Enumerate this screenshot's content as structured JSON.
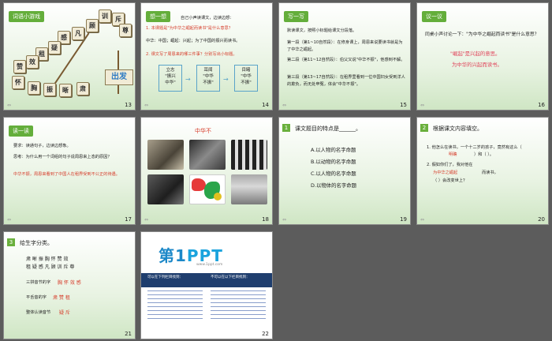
{
  "slides": [
    {
      "num": "13",
      "tag": "词语小游戏",
      "chars": [
        "训",
        "斥",
        "尊",
        "顾",
        "凡",
        "感",
        "疑",
        "租",
        "效",
        "赞",
        "怀",
        "胸",
        "振",
        "晰",
        "肃"
      ],
      "start": "出发"
    },
    {
      "num": "14",
      "header": "想一想",
      "lines": [
        "自己小声读课文，边读边想：",
        "1. 本课题是\"为中华之崛起而读书\"是什么意思？",
        "中华：中国；崛起：兴起；为了中国的振兴而读书。",
        "2. 课文写了周恩来的哪三件事？分别写出小标题。"
      ],
      "boxes": [
        "立志\n\"振兴\n中华\"",
        "耳闻\n\"中华\n不振\"",
        "目睹\n\"中华\n不振\""
      ]
    },
    {
      "num": "15",
      "header": "写一写",
      "lines": [
        "默读课文，按照小标题给课文分段落。",
        "第一段（第1~10自然段）：在修身课上，周恩来说要读书就是为了中华之崛起。",
        "第二段（第11~12自然段）：伯父又说\"中华不振\"，他感到不解。",
        "第三段（第13~17自然段）：在租界里看到一位中国妇女受到洋人的欺负，而无处申冤，体会\"中华不振\"。"
      ]
    },
    {
      "num": "16",
      "header": "议一议",
      "q": "同桌小声讨论一下：\"为中华之崛起而读书\"是什么意思？",
      "a1": "\"崛起\"是兴起的意思。",
      "a2": "为中华的兴起而读书。"
    },
    {
      "num": "17",
      "header": "读一读",
      "lines": [
        "要求：读通句子，边读边想象。",
        "思考：为什么用一个词组的句子说周恩来上态的原因？"
      ],
      "ans": "中华不振，周恩来看到了中国人在租界受到不公正的待遇。"
    },
    {
      "num": "18",
      "title": "中华不"
    },
    {
      "num": "19",
      "qnum": "1",
      "q": "课文题目的特点是______。",
      "opts": [
        "A.以人物的名字命题",
        "B.以动物的名字命题",
        "C.以人物的名字命题",
        "D.以物体的名字命题"
      ]
    },
    {
      "num": "20",
      "qnum": "2",
      "q": "根据课文内容填空。",
      "l1": "1. 他怎么在读书，一个十二岁的孩子，竟然有这么（",
      "f1": "明确",
      "l1b": "）和（  ）。",
      "l2": "2. 假如你们了，我对他在",
      "f2": "为中华之崛起",
      "f3": "而读书，",
      "l3": "（   ）会改变世上？"
    },
    {
      "num": "21",
      "header": "给生字分类。",
      "row1": "肃  晰  振  胸  怀  赞  效",
      "row2": "租  疑  感  凡  顾  训  斥  尊",
      "l1": "三拼音节的字",
      "v1": "胸  怀  效  感",
      "l2": "平舌音的字",
      "v2": "肃  赞  租",
      "l3": "整体认读音节",
      "v3": "疑  斥"
    },
    {
      "num": "22",
      "logo1": "第1",
      "logo2": "PPT",
      "sub": "www.1ppt.com",
      "t1": "可以在下列栏目找到：",
      "t2": "不可以在以下栏目找到："
    }
  ],
  "colors": {
    "green": "#64ae3b",
    "red": "#d63c2a",
    "blue": "#1c88c8"
  }
}
